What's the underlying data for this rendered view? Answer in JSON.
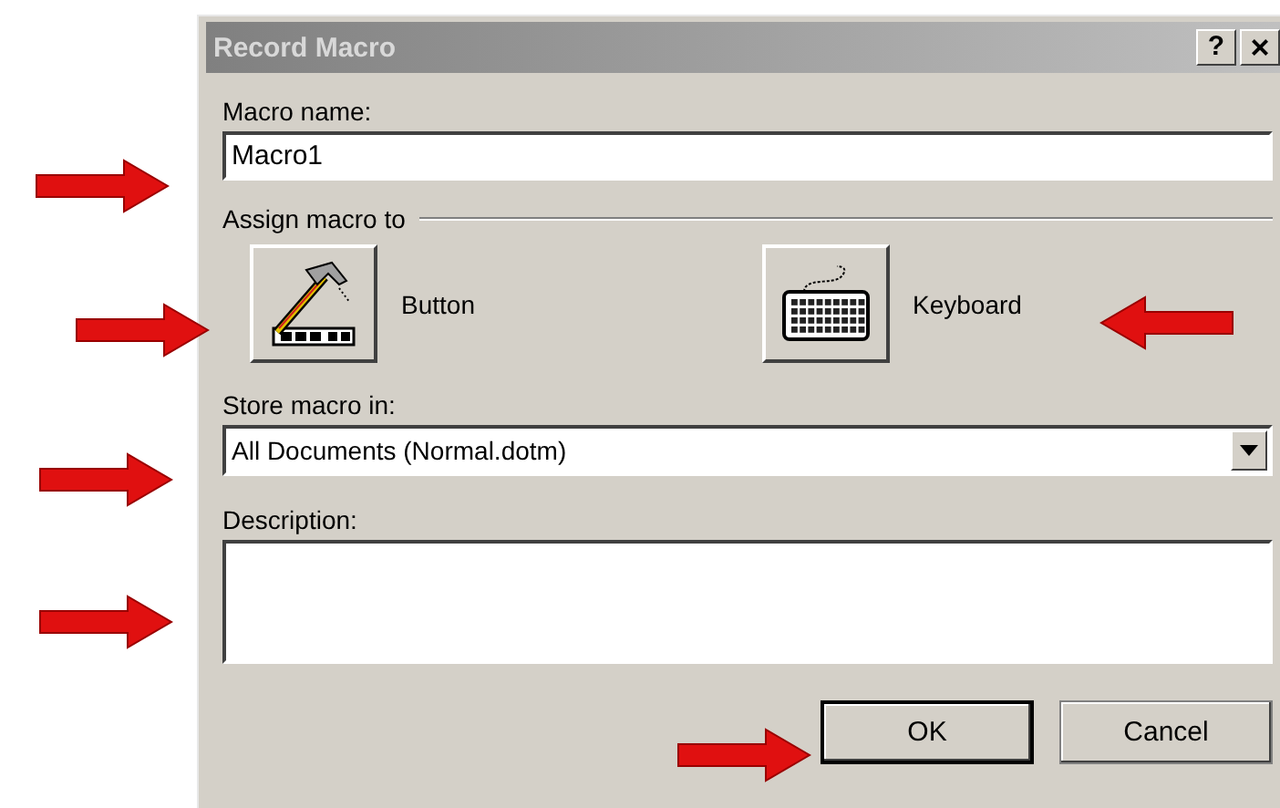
{
  "window": {
    "title": "Record Macro",
    "title_buttons": [
      {
        "kind": "help",
        "label": "?"
      },
      {
        "kind": "close",
        "label": "×"
      }
    ]
  },
  "macro_name": {
    "label": "Macro name:",
    "value": "Macro1"
  },
  "assign": {
    "label": "Assign macro to",
    "options": [
      {
        "kind": "button",
        "label": "Button"
      },
      {
        "kind": "keyboard",
        "label": "Keyboard"
      }
    ]
  },
  "store": {
    "label": "Store macro in:",
    "value": "All Documents (Normal.dotm)"
  },
  "description": {
    "label": "Description:"
  },
  "buttons": [
    {
      "label": "OK",
      "default": true
    },
    {
      "label": "Cancel",
      "default": false
    }
  ]
}
